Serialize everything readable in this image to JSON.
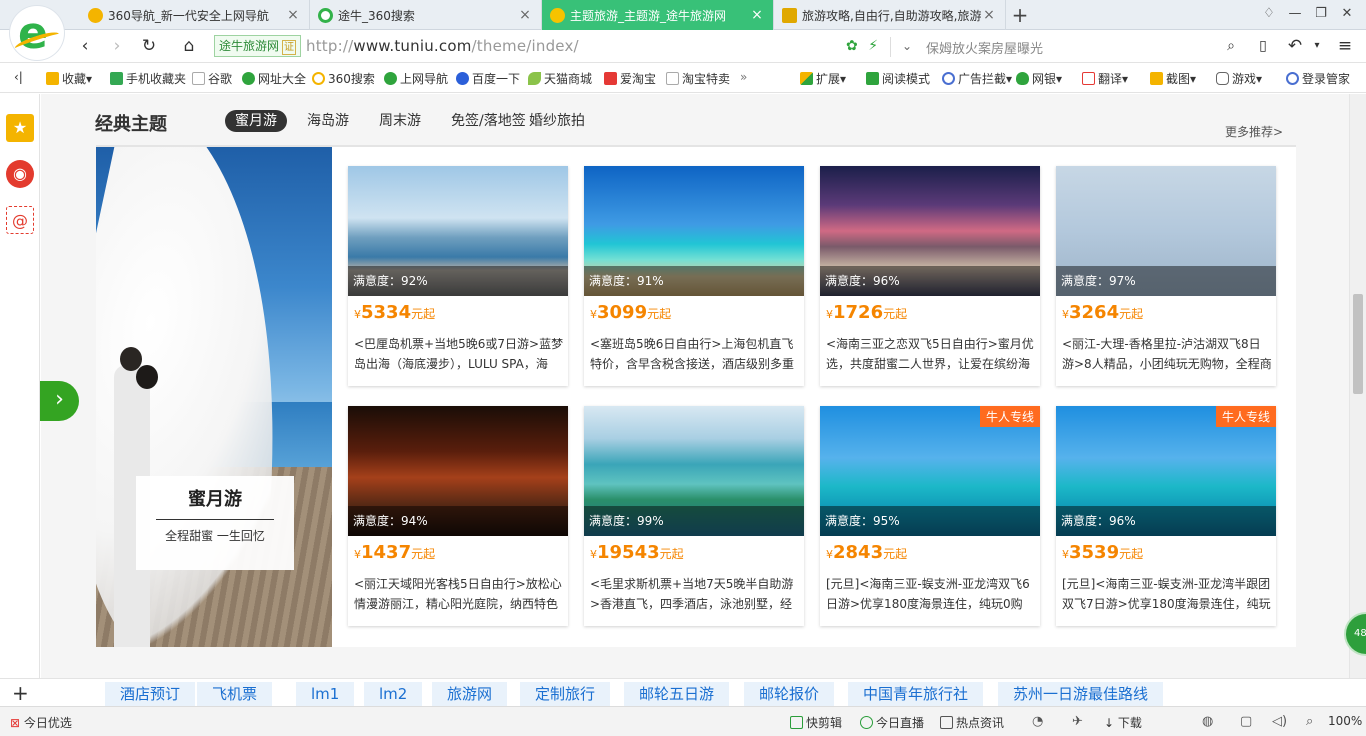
{
  "tabs": [
    {
      "label": "360导航_新一代安全上网导航",
      "icon": "360-nav-icon",
      "color": "#f4b400"
    },
    {
      "label": "途牛_360搜索",
      "icon": "360-search-icon",
      "color": "#33b24a"
    },
    {
      "label": "主题旅游_主题游_途牛旅游网",
      "icon": "tuniu-icon",
      "color": "#f6c300"
    },
    {
      "label": "旅游攻略,自由行,自助游攻略,旅游",
      "icon": "mail-icon",
      "color": "#e0a800"
    }
  ],
  "address": {
    "secure_label": "途牛旅游网",
    "cert_label": "证",
    "url_prefix": "http://",
    "url_host": "www.tuniu.com",
    "url_path": "/theme/index/",
    "search_hint": "保姆放火案房屋曝光"
  },
  "bookmarks": [
    {
      "label": "收藏",
      "icon": "star-icon"
    },
    {
      "label": "手机收藏夹",
      "icon": "phone-icon"
    },
    {
      "label": "谷歌",
      "icon": "doc-icon"
    },
    {
      "label": "网址大全",
      "icon": "360-nav-icon"
    },
    {
      "label": "360搜索",
      "icon": "360-search-icon"
    },
    {
      "label": "上网导航",
      "icon": "360-nav-icon"
    },
    {
      "label": "百度一下",
      "icon": "baidu-icon"
    },
    {
      "label": "天猫商城",
      "icon": "tmall-icon"
    },
    {
      "label": "爱淘宝",
      "icon": "taobao-icon"
    },
    {
      "label": "淘宝特卖",
      "icon": "doc-icon"
    }
  ],
  "toolbar": [
    {
      "label": "扩展",
      "icon": "extension-icon"
    },
    {
      "label": "阅读模式",
      "icon": "book-icon"
    },
    {
      "label": "广告拦截",
      "icon": "block-icon"
    },
    {
      "label": "网银",
      "icon": "shield-icon"
    },
    {
      "label": "翻译",
      "icon": "translate-icon"
    },
    {
      "label": "截图",
      "icon": "scissors-icon"
    },
    {
      "label": "游戏",
      "icon": "gamepad-icon"
    },
    {
      "label": "登录管家",
      "icon": "key-icon"
    }
  ],
  "section": {
    "title": "经典主题",
    "tabs": [
      "蜜月游",
      "海岛游",
      "周末游",
      "免签/落地签",
      "婚纱旅拍"
    ],
    "more": "更多推荐>"
  },
  "hero": {
    "title": "蜜月游",
    "subtitle": "全程甜蜜 一生回忆"
  },
  "products": [
    {
      "satisfaction": "满意度：92%",
      "currency": "¥",
      "price": "5334",
      "unit": "元起",
      "desc": "<巴厘岛机票+当地5晚6或7日游>蓝梦岛出海（海底漫步），LULU SPA，海",
      "photo": "p-infinity",
      "tag": ""
    },
    {
      "satisfaction": "满意度：91%",
      "currency": "¥",
      "price": "3099",
      "unit": "元起",
      "desc": "<塞班岛5晚6日自由行>上海包机直飞特价，含早含税含接送，酒店级别多重",
      "photo": "p-beach-palm",
      "tag": ""
    },
    {
      "satisfaction": "满意度：96%",
      "currency": "¥",
      "price": "1726",
      "unit": "元起",
      "desc": "<海南三亚之恋双飞5日自由行>蜜月优选，共度甜蜜二人世界，让爱在缤纷海",
      "photo": "p-hotel-dusk",
      "tag": ""
    },
    {
      "satisfaction": "满意度：97%",
      "currency": "¥",
      "price": "3264",
      "unit": "元起",
      "desc": "<丽江-大理-香格里拉-泸沽湖双飞8日游>8人精品，小团纯玩无购物，全程商",
      "photo": "p-snow-lake",
      "tag": ""
    },
    {
      "satisfaction": "满意度：94%",
      "currency": "¥",
      "price": "1437",
      "unit": "元起",
      "desc": "<丽江天域阳光客栈5日自由行>放松心情漫游丽江，精心阳光庭院，纳西特色",
      "photo": "p-inn-night",
      "tag": ""
    },
    {
      "satisfaction": "满意度：99%",
      "currency": "¥",
      "price": "19543",
      "unit": "元起",
      "desc": "<毛里求斯机票+当地7天5晚半自助游>香港直飞，四季酒店，泳池别墅，经典",
      "photo": "p-island-aerial",
      "tag": ""
    },
    {
      "satisfaction": "满意度：95%",
      "currency": "¥",
      "price": "2843",
      "unit": "元起",
      "desc": "[元旦]<海南三亚-蜈支洲-亚龙湾双飞6日游>优享180度海景连住，纯玩0购",
      "photo": "p-banana-boat",
      "tag": "牛人专线"
    },
    {
      "satisfaction": "满意度：96%",
      "currency": "¥",
      "price": "3539",
      "unit": "元起",
      "desc": "[元旦]<海南三亚-蜈支洲-亚龙湾半跟团双飞7日游>优享180度海景连住，纯玩",
      "photo": "p-banana-boat",
      "tag": "牛人专线"
    }
  ],
  "footer_links": [
    "酒店预订",
    "飞机票",
    "lm1",
    "lm2",
    "旅游网",
    "定制旅行",
    "邮轮五日游",
    "邮轮报价",
    "中国青年旅行社",
    "苏州一日游最佳路线"
  ],
  "status": {
    "left": "今日优选",
    "items": [
      "快剪辑",
      "今日直播",
      "热点资讯",
      "下载"
    ],
    "zoom": "100%",
    "bubble": "48"
  },
  "colors": {
    "accent_green": "#38c178",
    "price_orange": "#f58500",
    "link_blue": "#1a6fd1",
    "tag_orange": "#ff6b1f"
  }
}
